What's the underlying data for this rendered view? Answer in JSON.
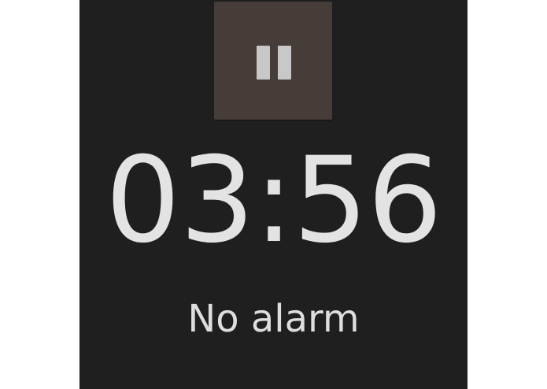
{
  "clock": {
    "time": "03:56",
    "alarm_status": "No alarm"
  },
  "controls": {
    "pause_icon": "pause-icon"
  },
  "colors": {
    "background": "#1f1f1f",
    "button": "#463c38",
    "text": "#e3e3e3"
  }
}
